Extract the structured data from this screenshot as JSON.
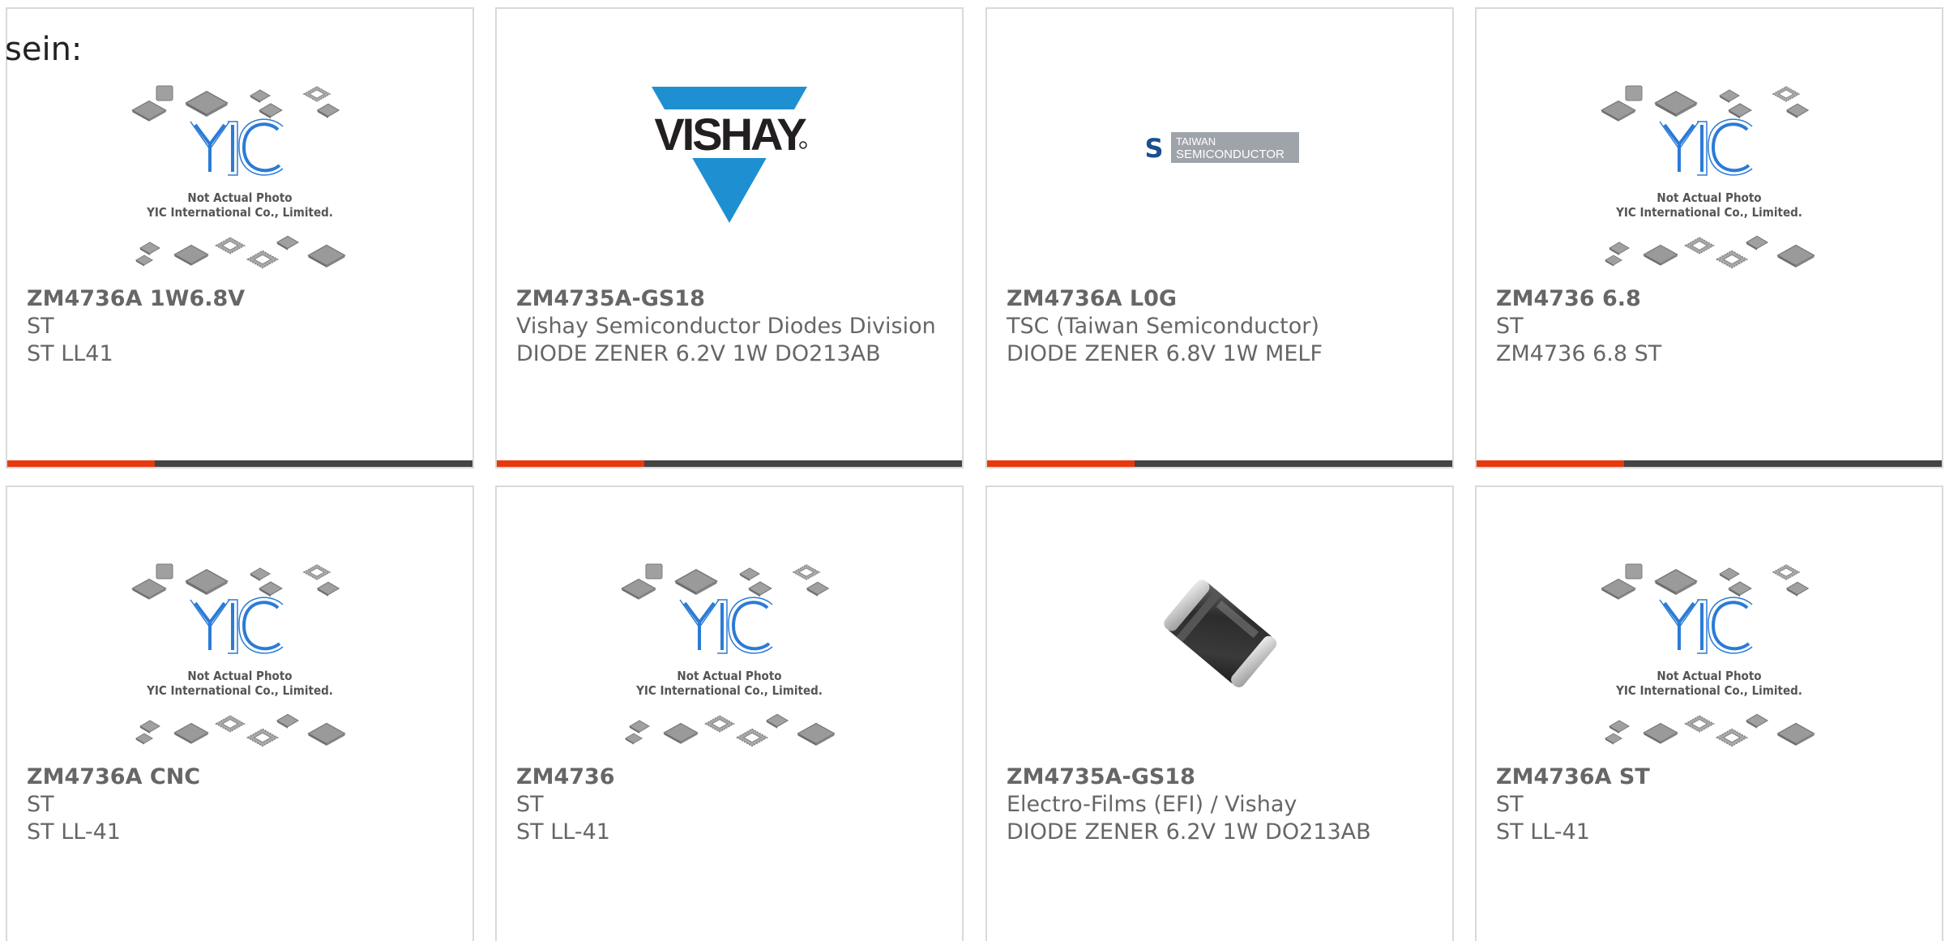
{
  "heading_fragment": "sein:",
  "colors": {
    "accent": "#e8380d",
    "bar": "#444444",
    "border": "#d9d9d9",
    "text": "#666666",
    "vishay_blue": "#1e8fd1",
    "yic_blue": "#2b7bd6"
  },
  "placeholder": {
    "line1": "Not Actual Photo",
    "line2": "YIC International Co., Limited.",
    "brand": "YIC"
  },
  "logos": {
    "vishay": "VISHAY",
    "taiwan_line1": "TAIWAN",
    "taiwan_line2": "SEMICONDUCTOR",
    "taiwan_mark": "S"
  },
  "cards": [
    {
      "part": "ZM4736A 1W6.8V",
      "manufacturer": "ST",
      "description": "ST LL41",
      "image": "yic-placeholder"
    },
    {
      "part": "ZM4735A-GS18",
      "manufacturer": "Vishay Semiconductor Diodes Division",
      "description": "DIODE ZENER 6.2V 1W DO213AB",
      "image": "vishay-logo"
    },
    {
      "part": "ZM4736A L0G",
      "manufacturer": "TSC (Taiwan Semiconductor)",
      "description": "DIODE ZENER 6.8V 1W MELF",
      "image": "taiwan-semiconductor-logo"
    },
    {
      "part": "ZM4736 6.8",
      "manufacturer": "ST",
      "description": "ZM4736 6.8 ST",
      "image": "yic-placeholder"
    },
    {
      "part": "ZM4736A CNC",
      "manufacturer": "ST",
      "description": "ST LL-41",
      "image": "yic-placeholder"
    },
    {
      "part": "ZM4736",
      "manufacturer": "ST",
      "description": "ST LL-41",
      "image": "yic-placeholder"
    },
    {
      "part": "ZM4735A-GS18",
      "manufacturer": "Electro-Films (EFI) / Vishay",
      "description": "DIODE ZENER 6.2V 1W DO213AB",
      "image": "melf-diode-photo"
    },
    {
      "part": "ZM4736A ST",
      "manufacturer": "ST",
      "description": "ST LL-41",
      "image": "yic-placeholder"
    }
  ]
}
